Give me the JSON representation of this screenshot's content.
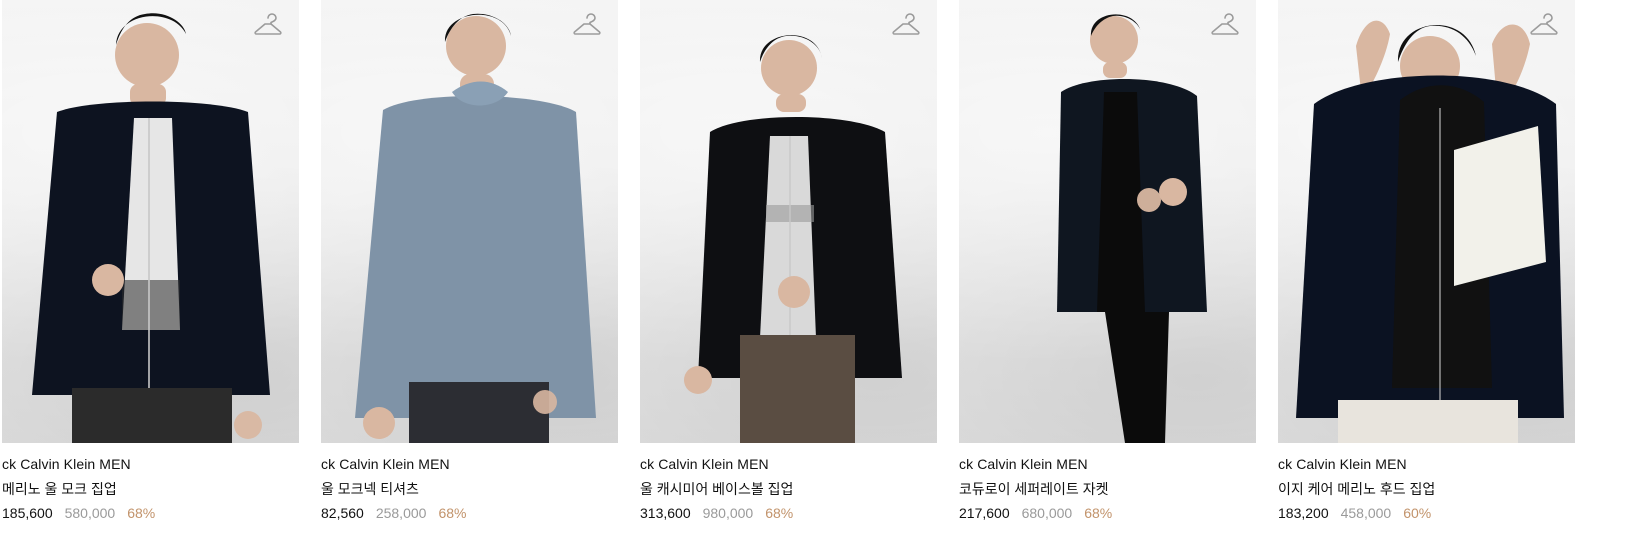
{
  "products": [
    {
      "brand": "ck Calvin Klein MEN",
      "name": "메리노 울 모크 집업",
      "price": "185,600",
      "original_price": "580,000",
      "discount": "68%",
      "palette": {
        "top": "#0d1320",
        "inner": "#e6e6e6",
        "pants": "#2b2b2b",
        "skin": "#d9b7a1"
      }
    },
    {
      "brand": "ck Calvin Klein MEN",
      "name": "울 모크넥 티셔츠",
      "price": "82,560",
      "original_price": "258,000",
      "discount": "68%",
      "palette": {
        "top": "#7f93a7",
        "inner": "#7f93a7",
        "pants": "#2c2d33",
        "skin": "#d9b7a1"
      }
    },
    {
      "brand": "ck Calvin Klein MEN",
      "name": "울 캐시미어 베이스볼 집업",
      "price": "313,600",
      "original_price": "980,000",
      "discount": "68%",
      "palette": {
        "top": "#0e0f12",
        "inner": "#d9d9d9",
        "pants": "#5a4d42",
        "skin": "#d9b7a1"
      }
    },
    {
      "brand": "ck Calvin Klein MEN",
      "name": "코듀로이 세퍼레이트 자켓",
      "price": "217,600",
      "original_price": "680,000",
      "discount": "68%",
      "palette": {
        "top": "#0f1620",
        "inner": "#0b0b0b",
        "pants": "#0b0b0b",
        "skin": "#d9b7a1"
      }
    },
    {
      "brand": "ck Calvin Klein MEN",
      "name": "이지 케어 메리노 후드 집업",
      "price": "183,200",
      "original_price": "458,000",
      "discount": "60%",
      "palette": {
        "top": "#0b1222",
        "inner": "#111111",
        "pants": "#e8e4dd",
        "skin": "#d9b7a1",
        "accent": "#f2f1ea"
      }
    }
  ]
}
